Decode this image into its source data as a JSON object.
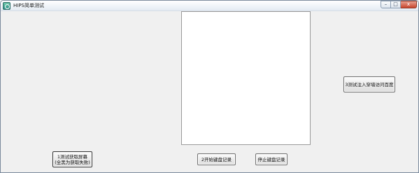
{
  "window": {
    "title": "HIPS简单测试",
    "controls": {
      "minimize": "–",
      "maximize": "□",
      "close": "x"
    }
  },
  "buttons": {
    "inject_visit": "3测试注入穿墙访问百度",
    "screenshot_line1": "1测试获取屏幕",
    "screenshot_line2": "(全黑为获取失败)",
    "start_keyboard_log": "2开始键盘记录",
    "stop_keyboard_log": "停止键盘记录"
  }
}
